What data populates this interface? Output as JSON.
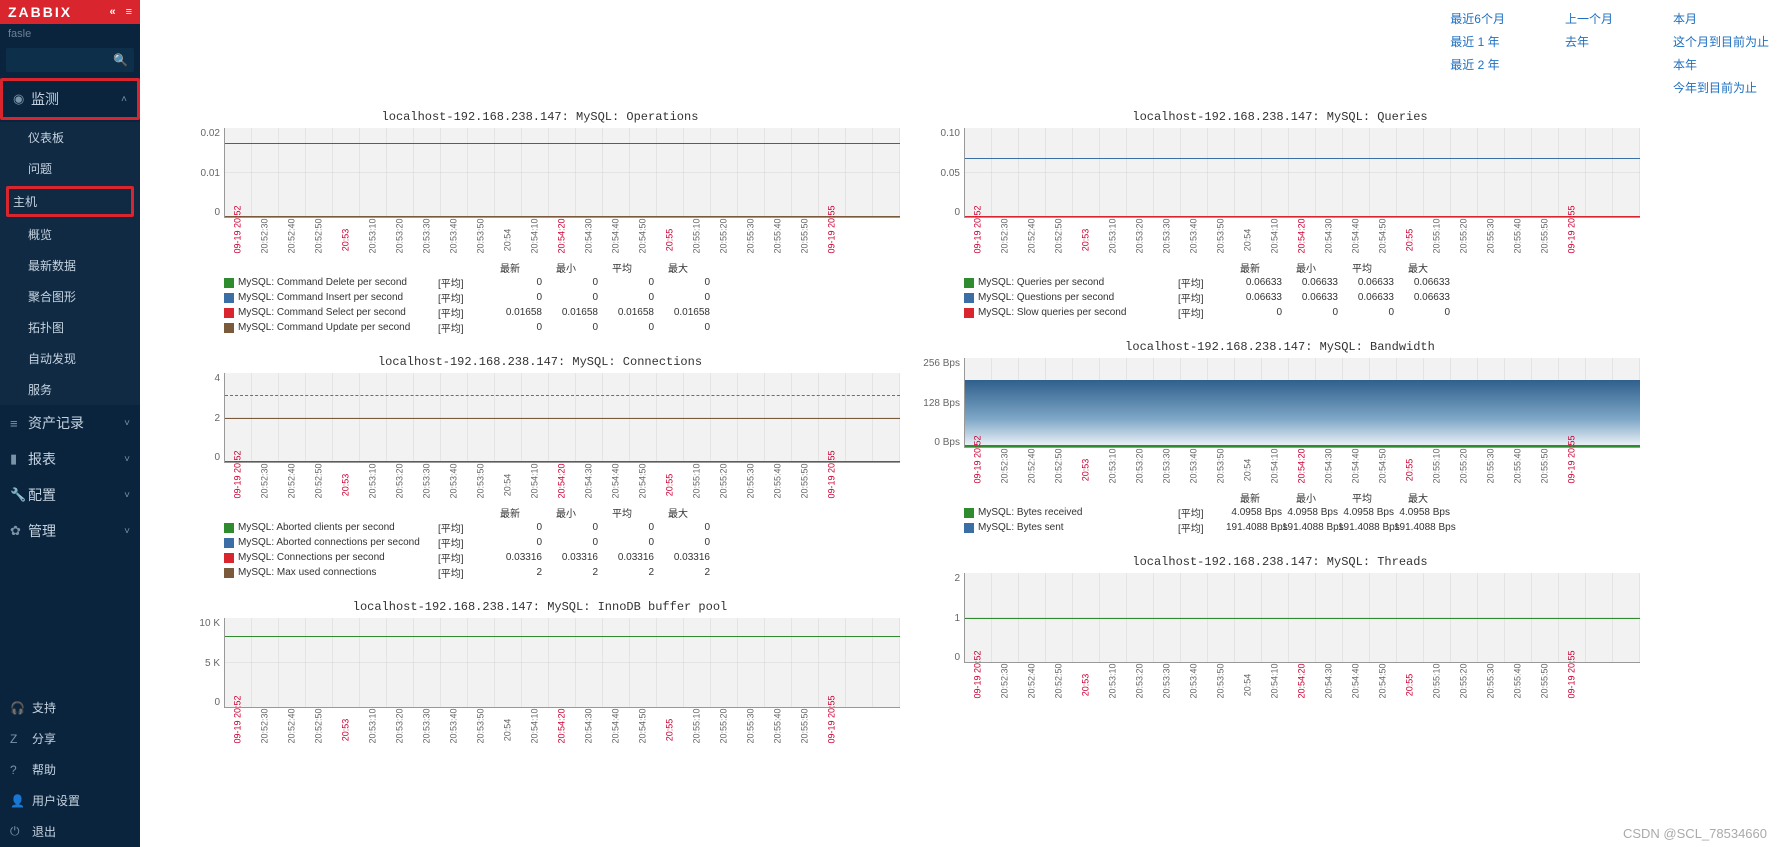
{
  "brand": "ZABBIX",
  "user": "fasle",
  "nav": {
    "monitor": {
      "label": "监测",
      "open": true,
      "items": [
        {
          "k": "dashboards",
          "label": "仪表板"
        },
        {
          "k": "problems",
          "label": "问题"
        },
        {
          "k": "hosts",
          "label": "主机"
        },
        {
          "k": "overview",
          "label": "概览"
        },
        {
          "k": "latest",
          "label": "最新数据"
        },
        {
          "k": "screens",
          "label": "聚合图形"
        },
        {
          "k": "maps",
          "label": "拓扑图"
        },
        {
          "k": "discovery",
          "label": "自动发现"
        },
        {
          "k": "services",
          "label": "服务"
        }
      ]
    },
    "sections": [
      {
        "k": "inventory",
        "label": "资产记录"
      },
      {
        "k": "reports",
        "label": "报表"
      },
      {
        "k": "config",
        "label": "配置"
      },
      {
        "k": "admin",
        "label": "管理"
      }
    ],
    "bottom": [
      {
        "k": "support",
        "label": "支持"
      },
      {
        "k": "share",
        "label": "分享"
      },
      {
        "k": "help",
        "label": "帮助"
      },
      {
        "k": "usersettings",
        "label": "用户设置"
      },
      {
        "k": "logout",
        "label": "退出"
      }
    ]
  },
  "timefilter": {
    "col1": [
      "",
      "最近6个月",
      "最近 1 年",
      "最近 2 年"
    ],
    "col2": [
      "",
      "上一个月",
      "去年",
      ""
    ],
    "col3": [
      "",
      "本月",
      "这个月到目前为止",
      "本年",
      "今年到目前为止"
    ]
  },
  "host": "localhost-192.168.238.147",
  "x_ticks": [
    "09-19 20:52",
    "20:52:30",
    "20:52:40",
    "20:52:50",
    "20:53",
    "20:53:10",
    "20:53:20",
    "20:53:30",
    "20:53:40",
    "20:53:50",
    "20:54",
    "20:54:10",
    "20:54:20",
    "20:54:30",
    "20:54:40",
    "20:54:50",
    "20:55",
    "20:55:10",
    "20:55:20",
    "20:55:30",
    "20:55:40",
    "20:55:50",
    "09-19 20:55"
  ],
  "x_red": [
    0,
    4,
    12,
    16,
    22
  ],
  "legend_cols": {
    "latest": "最新",
    "min": "最小",
    "avg": "平均",
    "max": "最大"
  },
  "agg": "[平均]",
  "chart_data": [
    {
      "id": "ops",
      "title": "MySQL: Operations",
      "y": [
        "0.02",
        "0.01",
        "0"
      ],
      "series": [
        {
          "name": "MySQL: Command Delete per second",
          "color": "#2e8b2e",
          "vals": [
            "0",
            "0",
            "0",
            "0"
          ]
        },
        {
          "name": "MySQL: Command Insert per second",
          "color": "#3a6ea5",
          "vals": [
            "0",
            "0",
            "0",
            "0"
          ]
        },
        {
          "name": "MySQL: Command Select per second",
          "color": "#d9252d",
          "vals": [
            "0.01658",
            "0.01658",
            "0.01658",
            "0.01658"
          ],
          "y_pct": 17
        },
        {
          "name": "MySQL: Command Update per second",
          "color": "#7a5a3a",
          "vals": [
            "0",
            "0",
            "0",
            "0"
          ]
        }
      ]
    },
    {
      "id": "queries",
      "title": "MySQL: Queries",
      "y": [
        "0.10",
        "0.05",
        "0"
      ],
      "series": [
        {
          "name": "MySQL: Queries per second",
          "color": "#2e8b2e",
          "vals": [
            "0.06633",
            "0.06633",
            "0.06633",
            "0.06633"
          ],
          "y_pct": 33.7
        },
        {
          "name": "MySQL: Questions per second",
          "color": "#3a6ea5",
          "vals": [
            "0.06633",
            "0.06633",
            "0.06633",
            "0.06633"
          ],
          "y_pct": 33.4
        },
        {
          "name": "MySQL: Slow queries per second",
          "color": "#d9252d",
          "vals": [
            "0",
            "0",
            "0",
            "0"
          ]
        }
      ]
    },
    {
      "id": "conn",
      "title": "MySQL: Connections",
      "y": [
        "4",
        "2",
        "0"
      ],
      "series": [
        {
          "name": "MySQL: Aborted clients per second",
          "color": "#2e8b2e",
          "vals": [
            "0",
            "0",
            "0",
            "0"
          ]
        },
        {
          "name": "MySQL: Aborted connections per second",
          "color": "#3a6ea5",
          "vals": [
            "0",
            "0",
            "0",
            "0"
          ]
        },
        {
          "name": "MySQL: Connections per second",
          "color": "#d9252d",
          "vals": [
            "0.03316",
            "0.03316",
            "0.03316",
            "0.03316"
          ]
        },
        {
          "name": "MySQL: Max used connections",
          "color": "#7a5a3a",
          "vals": [
            "2",
            "2",
            "2",
            "2"
          ],
          "y_pct": 50
        },
        {
          "name": "__dashed",
          "color": "#c05c00",
          "y_pct": 25,
          "dashed": true
        }
      ]
    },
    {
      "id": "bw",
      "title": "MySQL: Bandwidth",
      "y": [
        "256 Bps",
        "128 Bps",
        "0 Bps"
      ],
      "series": [
        {
          "name": "MySQL: Bytes received",
          "color": "#2e8b2e",
          "vals": [
            "4.0958 Bps",
            "4.0958 Bps",
            "4.0958 Bps",
            "4.0958 Bps"
          ],
          "area_to": 98,
          "area_from": 100,
          "area_color": "#2e8b2e"
        },
        {
          "name": "MySQL: Bytes sent",
          "color": "#3a6ea5",
          "vals": [
            "191.4088 Bps",
            "191.4088 Bps",
            "191.4088 Bps",
            "191.4088 Bps"
          ],
          "area_to": 25,
          "area_from": 98,
          "area_color": "linear-gradient(#2f5f8c,#7ea7c7 60%,#e8eff5)"
        }
      ]
    },
    {
      "id": "buf",
      "title": "MySQL: InnoDB buffer pool",
      "y": [
        "10 K",
        "5 K",
        "0"
      ],
      "series": [
        {
          "name": "",
          "color": "#2e8b2e",
          "y_pct": 20
        }
      ]
    },
    {
      "id": "thr",
      "title": "MySQL: Threads",
      "y": [
        "2",
        "1",
        "0"
      ],
      "series": [
        {
          "name": "",
          "color": "#2e8b2e",
          "y_pct": 50
        }
      ]
    }
  ],
  "watermark": "CSDN @SCL_78534660"
}
